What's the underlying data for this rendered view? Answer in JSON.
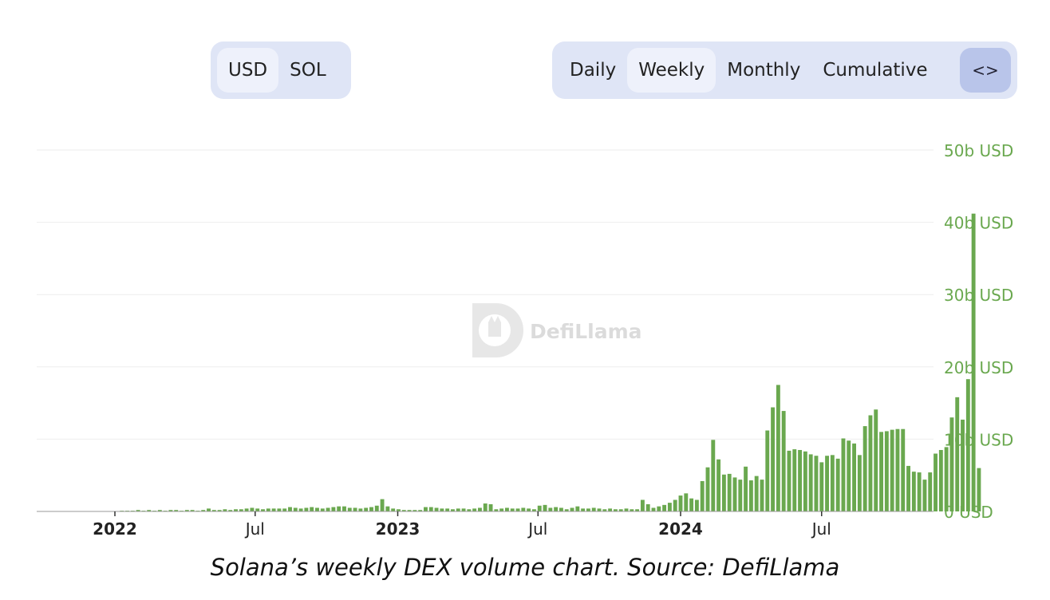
{
  "toggles": {
    "units": [
      {
        "label": "USD",
        "active": true
      },
      {
        "label": "SOL",
        "active": false
      }
    ],
    "periods": [
      {
        "label": "Daily",
        "active": false
      },
      {
        "label": "Weekly",
        "active": true
      },
      {
        "label": "Monthly",
        "active": false
      },
      {
        "label": "Cumulative",
        "active": false
      }
    ],
    "embed_label": "<>"
  },
  "watermark": "DefiLlama",
  "caption": "Solana’s weekly DEX volume chart. Source: DefiLlama",
  "colors": {
    "bar": "#6aa84f",
    "axis_label": "#6aa84f",
    "grid": "#eeeeee",
    "toggle_bg": "#dfe5f6",
    "toggle_active": "#eef1fb",
    "embed_bg": "#b9c5ea"
  },
  "chart_data": {
    "type": "bar",
    "title": "",
    "xlabel": "",
    "ylabel": "",
    "ylim": [
      0,
      50
    ],
    "y_unit": "b USD",
    "y_ticks": [
      "0 USD",
      "10b USD",
      "20b USD",
      "30b USD",
      "40b USD",
      "50b USD"
    ],
    "x_ticks": [
      {
        "label": "2022",
        "date": "2022-01-01",
        "bold": true
      },
      {
        "label": "Jul",
        "date": "2022-07-01",
        "bold": false
      },
      {
        "label": "2023",
        "date": "2023-01-01",
        "bold": true
      },
      {
        "label": "Jul",
        "date": "2023-07-01",
        "bold": false
      },
      {
        "label": "2024",
        "date": "2024-01-01",
        "bold": true
      },
      {
        "label": "Jul",
        "date": "2024-07-01",
        "bold": false
      }
    ],
    "x_start": "2021-09-20",
    "bar_interval_days": 7,
    "grid": true,
    "legend": "none",
    "series": [
      {
        "values": [
          0,
          0,
          0,
          0,
          0,
          0,
          0,
          0,
          0,
          0,
          0,
          0,
          0,
          0,
          0,
          0,
          0.1,
          0.1,
          0.1,
          0.2,
          0.1,
          0.2,
          0.1,
          0.2,
          0.1,
          0.2,
          0.2,
          0.1,
          0.2,
          0.2,
          0.1,
          0.2,
          0.4,
          0.2,
          0.2,
          0.3,
          0.2,
          0.3,
          0.3,
          0.4,
          0.5,
          0.4,
          0.3,
          0.4,
          0.4,
          0.4,
          0.4,
          0.6,
          0.5,
          0.4,
          0.5,
          0.6,
          0.5,
          0.4,
          0.5,
          0.6,
          0.7,
          0.7,
          0.5,
          0.5,
          0.4,
          0.5,
          0.6,
          0.8,
          1.7,
          0.7,
          0.4,
          0.3,
          0.2,
          0.2,
          0.2,
          0.2,
          0.6,
          0.6,
          0.5,
          0.4,
          0.4,
          0.3,
          0.4,
          0.4,
          0.3,
          0.4,
          0.5,
          1.1,
          1.0,
          0.3,
          0.4,
          0.5,
          0.4,
          0.4,
          0.5,
          0.4,
          0.3,
          0.8,
          0.9,
          0.5,
          0.6,
          0.5,
          0.3,
          0.5,
          0.7,
          0.4,
          0.4,
          0.5,
          0.4,
          0.3,
          0.4,
          0.3,
          0.3,
          0.4,
          0.3,
          0.3,
          1.6,
          1.0,
          0.5,
          0.7,
          0.9,
          1.2,
          1.6,
          2.2,
          2.5,
          1.8,
          1.6,
          4.2,
          6.1,
          9.9,
          7.2,
          5.1,
          5.2,
          4.7,
          4.4,
          6.2,
          4.3,
          4.9,
          4.4,
          11.2,
          14.4,
          17.5,
          13.9,
          8.4,
          8.6,
          8.5,
          8.3,
          7.9,
          7.7,
          6.8,
          7.7,
          7.8,
          7.3,
          10.1,
          9.8,
          9.4,
          7.8,
          11.8,
          13.3,
          14.1,
          11.0,
          11.1,
          11.3,
          11.4,
          11.4,
          6.3,
          5.5,
          5.4,
          4.4,
          5.4,
          8.0,
          8.5,
          8.9,
          13.0,
          15.8,
          12.7,
          18.3,
          41.2,
          6.0
        ]
      }
    ]
  }
}
